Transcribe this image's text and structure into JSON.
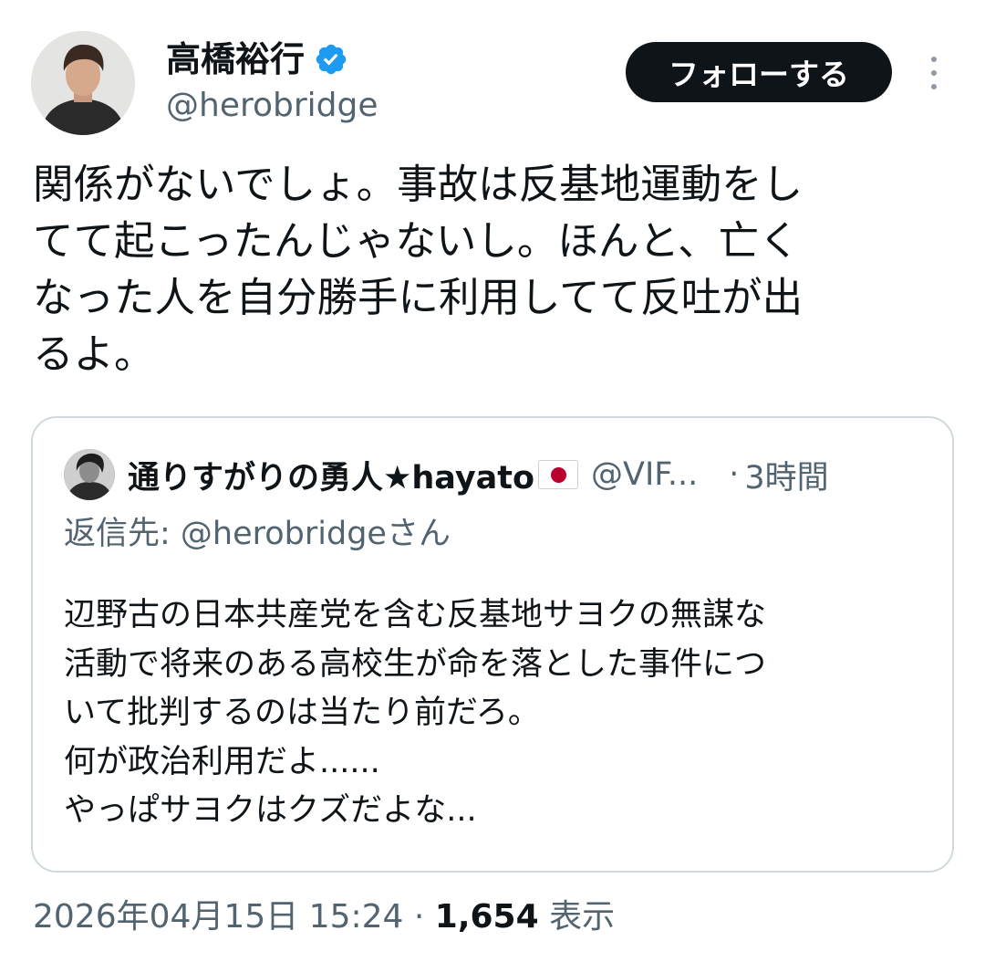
{
  "author": {
    "name": "高橋裕行",
    "handle": "@herobridge",
    "verified": true,
    "verified_color": "#1d9bf0"
  },
  "follow_button": {
    "label": "フォローする"
  },
  "more_button": {
    "icon": "more-vertical-icon"
  },
  "tweet": {
    "text": "関係がないでしょ。事故は反基地運動をし\nてて起こったんじゃないし。ほんと、亡く\nなった人を自分勝手に利用してて反吐が出\nるよ。"
  },
  "quote": {
    "name": "通りすがりの勇人★hayato",
    "flag_icon": "japan-flag-icon",
    "handle": "@VIF...",
    "separator": "·",
    "time": "3時間",
    "reply_prefix": "返信先: ",
    "reply_mention": "@herobridgeさん",
    "text": "辺野古の日本共産党を含む反基地サヨクの無謀な\n活動で将来のある高校生が命を落とした事件につ\nいて批判するのは当たり前だろ。\n何が政治利用だよ......\nやっぱサヨクはクズだよな..."
  },
  "meta": {
    "timestamp": "2026年04月15日 15:24",
    "separator": " · ",
    "views_count": "1,654",
    "views_label": " 表示"
  },
  "colors": {
    "text_primary": "#0f1419",
    "text_secondary": "#536471",
    "border": "#cfd9de",
    "button_bg": "#0f1419"
  }
}
